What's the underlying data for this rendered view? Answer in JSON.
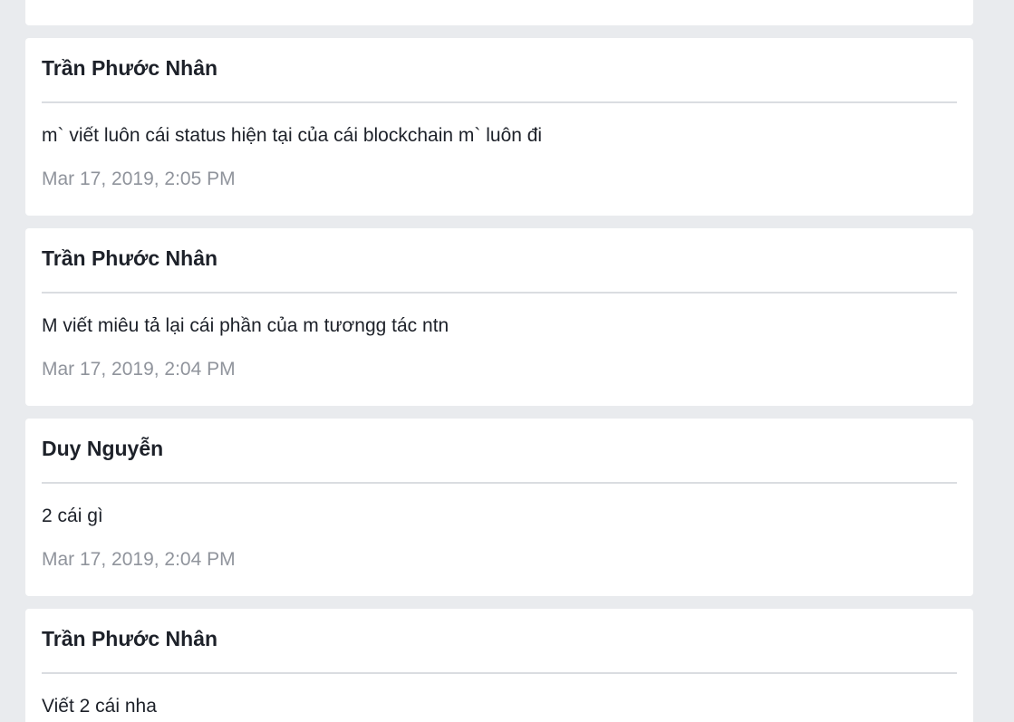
{
  "posts": [
    {
      "author": "Trần Phước Nhân",
      "message": "m` viết luôn cái status hiện tại của cái blockchain m` luôn đi",
      "timestamp": "Mar 17, 2019, 2:05 PM"
    },
    {
      "author": "Trần Phước Nhân",
      "message": "M viết miêu tả lại cái phần của m tươngg tác ntn",
      "timestamp": "Mar 17, 2019, 2:04 PM"
    },
    {
      "author": "Duy Nguyễn",
      "message": "2 cái gì",
      "timestamp": "Mar 17, 2019, 2:04 PM"
    },
    {
      "author": "Trần Phước Nhân",
      "message": "Viết 2 cái nha"
    }
  ]
}
